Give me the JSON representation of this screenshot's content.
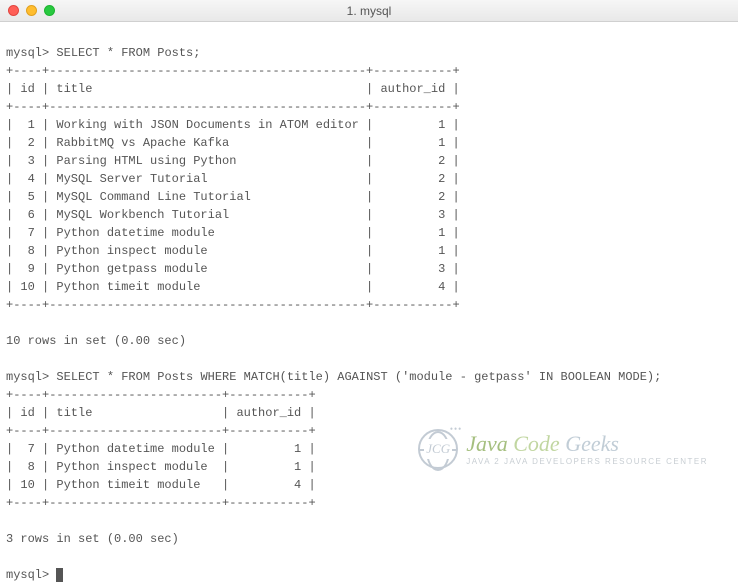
{
  "window": {
    "title": "1. mysql"
  },
  "session": {
    "prompt": "mysql>",
    "query1": "SELECT * FROM Posts;",
    "result1_summary": "10 rows in set (0.00 sec)",
    "query2": "SELECT * FROM Posts WHERE MATCH(title) AGAINST ('module - getpass' IN BOOLEAN MODE);",
    "result2_summary": "3 rows in set (0.00 sec)"
  },
  "table1": {
    "columns": [
      "id",
      "title",
      "author_id"
    ],
    "rows": [
      {
        "id": 1,
        "title": "Working with JSON Documents in ATOM editor",
        "author_id": 1
      },
      {
        "id": 2,
        "title": "RabbitMQ vs Apache Kafka",
        "author_id": 1
      },
      {
        "id": 3,
        "title": "Parsing HTML using Python",
        "author_id": 2
      },
      {
        "id": 4,
        "title": "MySQL Server Tutorial",
        "author_id": 2
      },
      {
        "id": 5,
        "title": "MySQL Command Line Tutorial",
        "author_id": 2
      },
      {
        "id": 6,
        "title": "MySQL Workbench Tutorial",
        "author_id": 3
      },
      {
        "id": 7,
        "title": "Python datetime module",
        "author_id": 1
      },
      {
        "id": 8,
        "title": "Python inspect module",
        "author_id": 1
      },
      {
        "id": 9,
        "title": "Python getpass module",
        "author_id": 3
      },
      {
        "id": 10,
        "title": "Python timeit module",
        "author_id": 4
      }
    ],
    "col_widths": {
      "id": 4,
      "title": 44,
      "author_id": 11
    }
  },
  "table2": {
    "columns": [
      "id",
      "title",
      "author_id"
    ],
    "rows": [
      {
        "id": 7,
        "title": "Python datetime module",
        "author_id": 1
      },
      {
        "id": 8,
        "title": "Python inspect module",
        "author_id": 1
      },
      {
        "id": 10,
        "title": "Python timeit module",
        "author_id": 4
      }
    ],
    "col_widths": {
      "id": 4,
      "title": 24,
      "author_id": 11
    }
  },
  "watermark": {
    "badge": "JCG",
    "main_java": "Java",
    "main_code": "Code",
    "main_geeks": "Geeks",
    "sub": "JAVA 2 JAVA DEVELOPERS RESOURCE CENTER"
  }
}
